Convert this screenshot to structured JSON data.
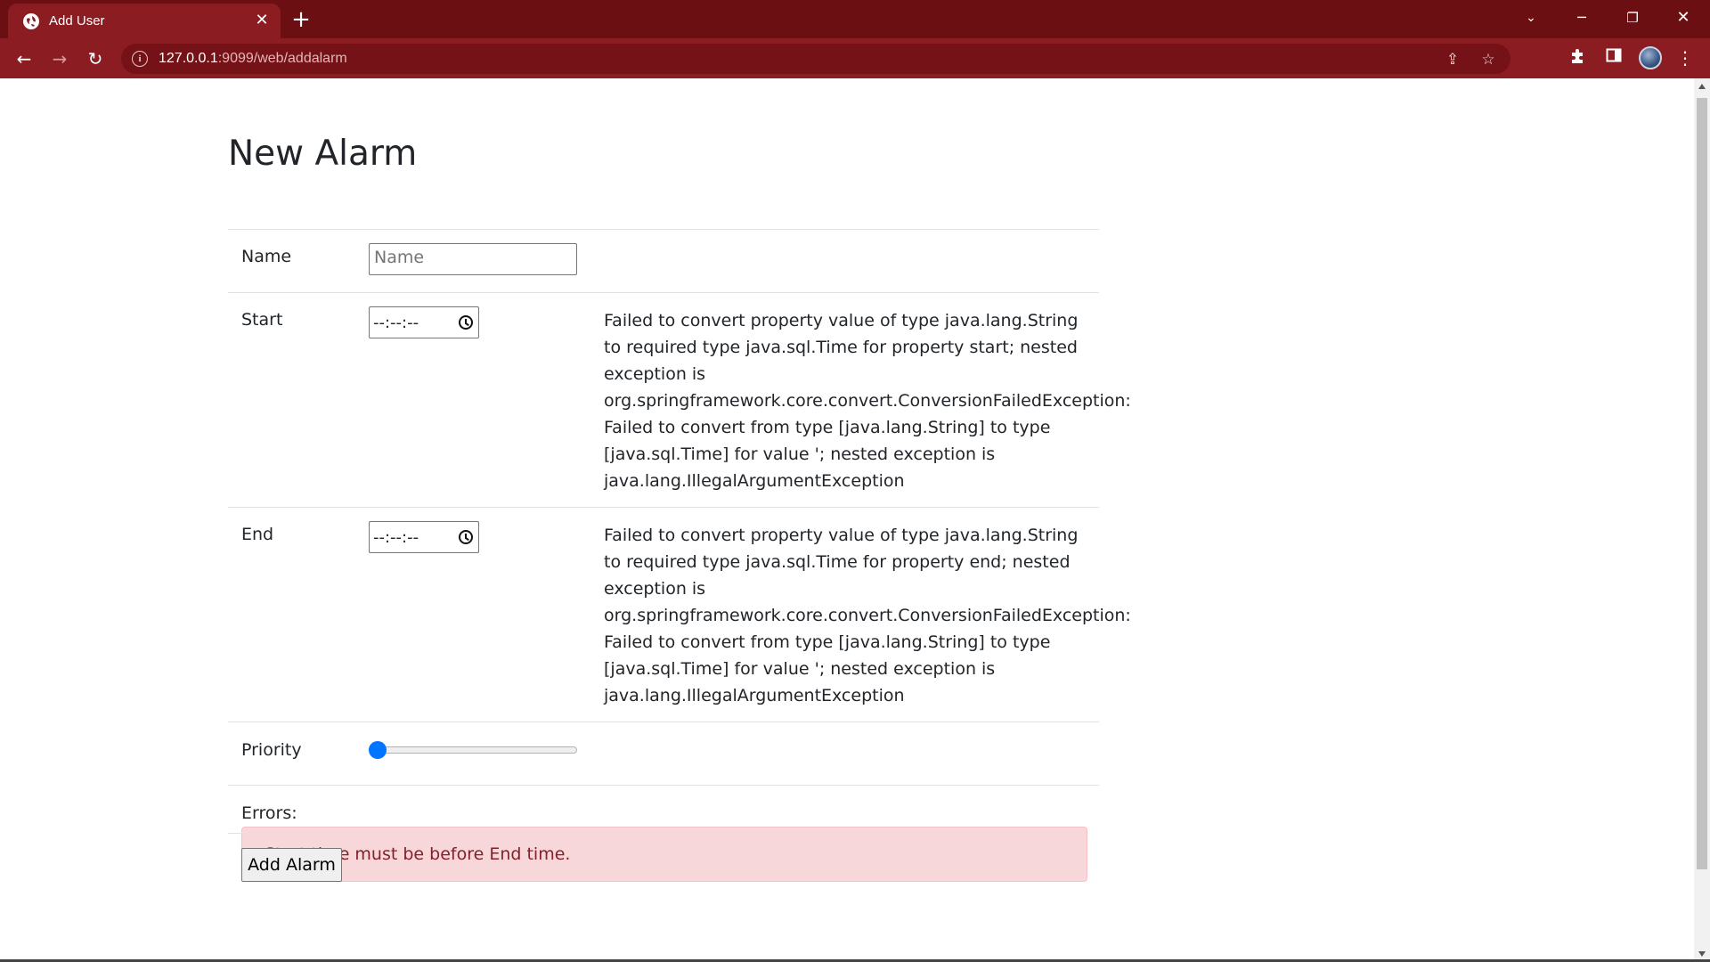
{
  "browser": {
    "tab_title": "Add User",
    "url_host": "127.0.0.1",
    "url_rest": ":9099/web/addalarm"
  },
  "page": {
    "title": "New Alarm",
    "fields": {
      "name": {
        "label": "Name",
        "placeholder": "Name"
      },
      "start": {
        "label": "Start",
        "value": "--:--:--",
        "error": "Failed to convert property value of type java.lang.String to required type java.sql.Time for property start; nested exception is org.springframework.core.convert.ConversionFailedException: Failed to convert from type [java.lang.String] to type [java.sql.Time] for value '; nested exception is java.lang.IllegalArgumentException"
      },
      "end": {
        "label": "End",
        "value": "--:--:--",
        "error": "Failed to convert property value of type java.lang.String to required type java.sql.Time for property end; nested exception is org.springframework.core.convert.ConversionFailedException: Failed to convert from type [java.lang.String] to type [java.sql.Time] for value '; nested exception is java.lang.IllegalArgumentException"
      },
      "priority": {
        "label": "Priority",
        "value": 0
      }
    },
    "errors": {
      "label": "Errors:",
      "message": "Start time must be before End time."
    },
    "submit_label": "Add Alarm"
  },
  "colors": {
    "tab_bar": "#6c0f13",
    "toolbar": "#8b1c21",
    "alert_bg": "#f8d7da",
    "alert_text": "#842029",
    "slider_thumb": "#0075ff"
  }
}
